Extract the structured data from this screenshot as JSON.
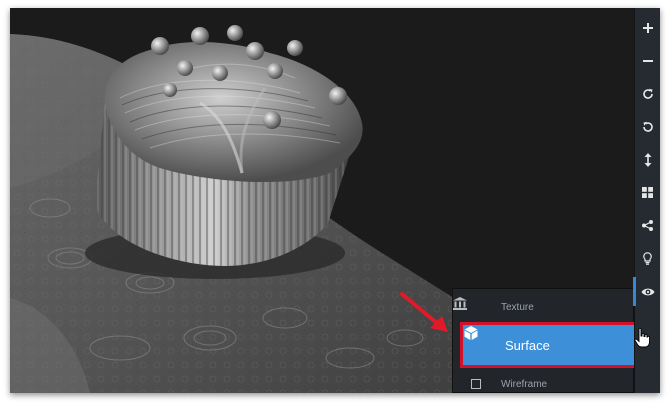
{
  "toolbar": {
    "tools": [
      {
        "icon": "zoom-in-icon",
        "glyph": "+"
      },
      {
        "icon": "zoom-out-icon",
        "glyph": "−"
      },
      {
        "icon": "rotate-clockwise-icon"
      },
      {
        "icon": "rotate-counterclockwise-icon"
      },
      {
        "icon": "vertical-arrows-icon"
      },
      {
        "icon": "grid-layout-icon"
      },
      {
        "icon": "share-icon"
      },
      {
        "icon": "lightbulb-icon"
      },
      {
        "icon": "eye-icon",
        "active": true
      }
    ],
    "accent_color": "#3a86d6"
  },
  "render_menu": {
    "items": [
      {
        "id": "texture",
        "label": "Texture",
        "icon": "museum-icon"
      },
      {
        "id": "surface",
        "label": "Surface",
        "icon": "cube-icon",
        "selected": true
      },
      {
        "id": "wireframe",
        "label": "Wireframe",
        "icon": "checkbox-icon"
      }
    ],
    "selected_color": "#3d8fd8",
    "highlight_color": "#d3122a"
  },
  "annotation": {
    "arrow_color": "#e11a2a"
  }
}
